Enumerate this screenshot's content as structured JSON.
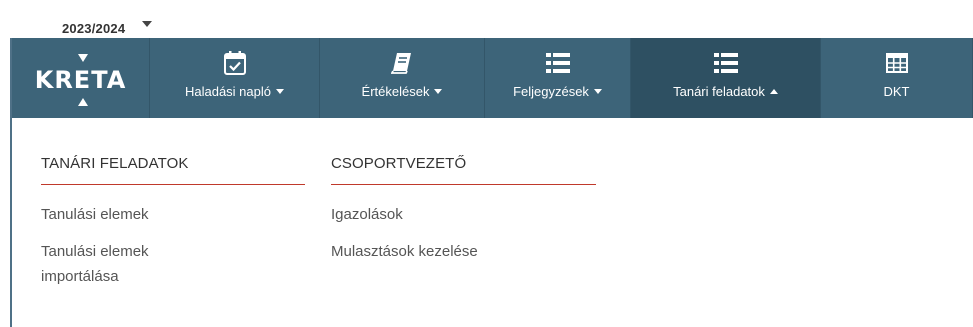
{
  "school_year": "2023/2024",
  "logo": {
    "text": "KRETA"
  },
  "colors": {
    "navbar": "#3d6479",
    "active_tab": "#2e5062",
    "heading_underline": "#c0392b"
  },
  "nav": [
    {
      "label": "Haladási napló",
      "icon": "calendar-check-icon",
      "caret": "down"
    },
    {
      "label": "Értékelések",
      "icon": "book-icon",
      "caret": "down"
    },
    {
      "label": "Feljegyzések",
      "icon": "list-icon",
      "caret": "down"
    },
    {
      "label": "Tanári feladatok",
      "icon": "list-icon",
      "caret": "up",
      "active": true
    },
    {
      "label": "DKT",
      "icon": "table-icon"
    }
  ],
  "dropdown": {
    "columns": [
      {
        "heading": "TANÁRI FELADATOK",
        "items": [
          "Tanulási elemek",
          "Tanulási elemek importálása"
        ]
      },
      {
        "heading": "CSOPORTVEZETŐ",
        "items": [
          "Igazolások",
          "Mulasztások kezelése"
        ]
      }
    ]
  }
}
